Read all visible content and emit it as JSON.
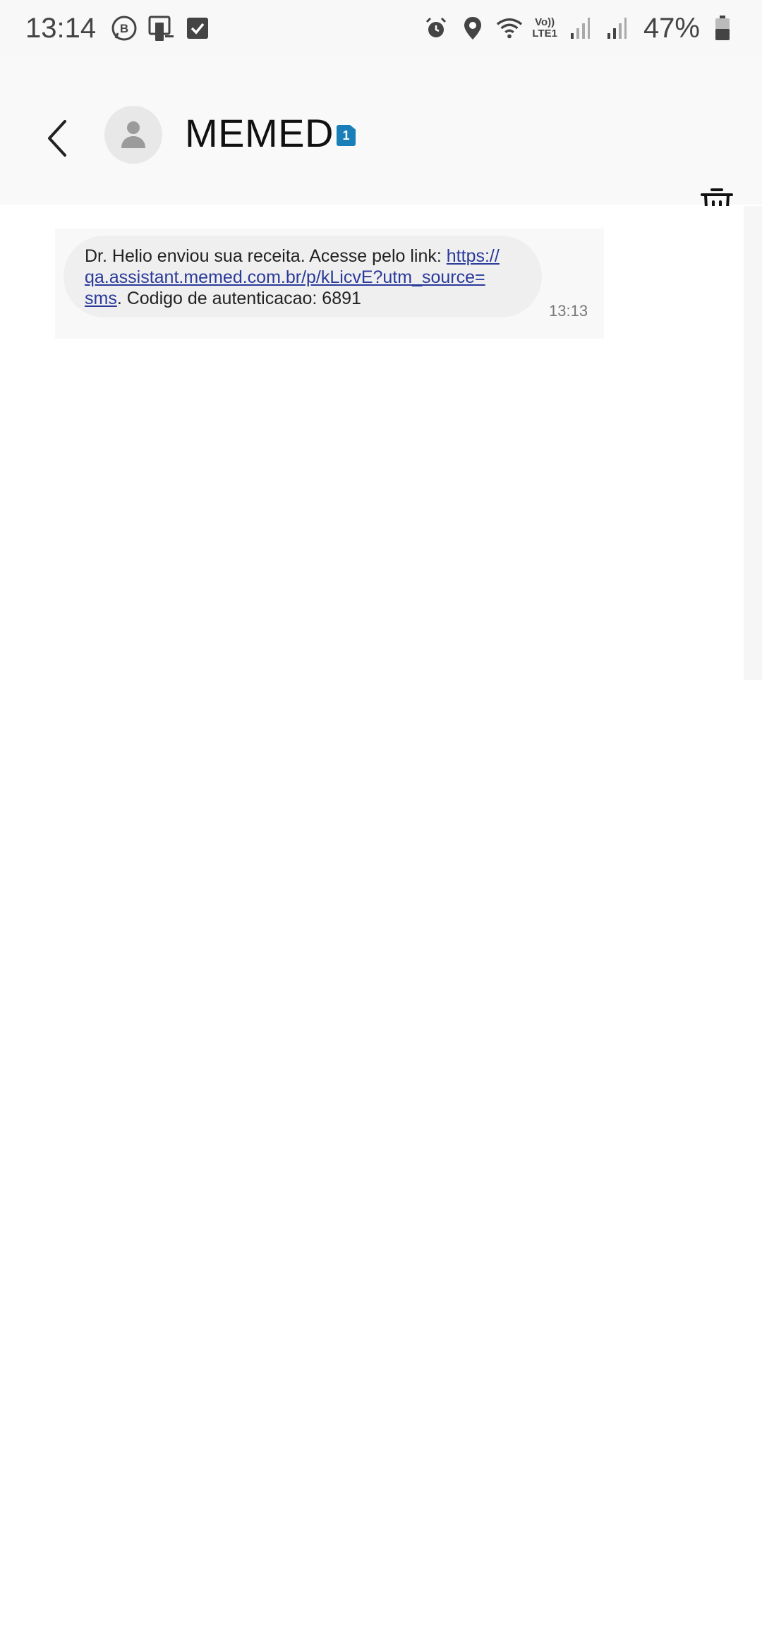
{
  "status_bar": {
    "time": "13:14",
    "battery_percent": "47%",
    "network_label_top": "Vo))",
    "network_label_bottom": "LTE1"
  },
  "header": {
    "contact_name": "MEMED",
    "sim_badge": "1"
  },
  "message": {
    "text_prefix": "Dr. Helio enviou sua receita. Acesse pelo link: ",
    "link_line1": "https://",
    "link_line2": "qa.assistant.memed.com.br/p/kLicvE?utm_source=",
    "link_line3": "sms",
    "text_suffix": ". Codigo de autenticacao: 6891",
    "time": "13:13"
  },
  "icons": {
    "back": "chevron-left-icon",
    "avatar": "person-icon",
    "delete": "trash-icon",
    "status": [
      "whatsapp-business-icon",
      "device-icon",
      "check-icon",
      "alarm-icon",
      "location-icon",
      "wifi-icon",
      "signal-icon",
      "signal-icon",
      "battery-icon"
    ]
  },
  "colors": {
    "link": "#2a3a9a",
    "sim_badge": "#1a7fb8",
    "bubble": "#efefef"
  }
}
